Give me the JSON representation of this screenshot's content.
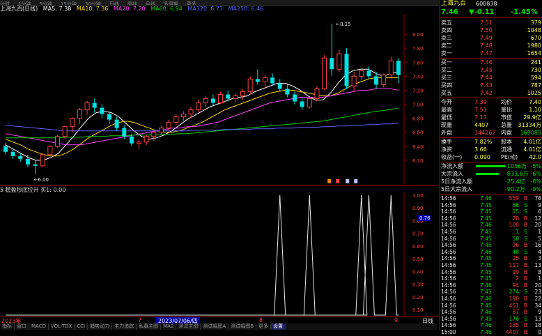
{
  "toolbar": {
    "items": [
      "分时",
      "1分钟",
      "5分钟",
      "15分钟",
      "30分钟",
      "日线",
      "周线",
      "月线",
      "多周期",
      "更多"
    ]
  },
  "header": {
    "title": "上海九百(日线)",
    "ma5": "MA5: 7.38",
    "ma10": "MA10: 7.36",
    "ma20": "MA20: 7.20",
    "ma60": "MA60: 6.94",
    "ma120": "MA120: 6.73",
    "ma250": "MA250: 6.46"
  },
  "colors": {
    "up": "#ff4040",
    "down": "#00e0e0",
    "ma5": "#ffffff",
    "ma10": "#ffd800",
    "ma20": "#ff40ff",
    "ma60": "#00d000",
    "ma120": "#6060ff",
    "ma250": "#e0e0e0"
  },
  "price_axis": {
    "ticks": [
      "8.00",
      "7.80",
      "7.60",
      "7.40",
      "7.20",
      "7.00",
      "6.80",
      "6.60",
      "6.40",
      "6.20"
    ]
  },
  "price_annotations": {
    "high": "8.15",
    "low": "6.00"
  },
  "candles": [
    {
      "o": 6.4,
      "h": 6.45,
      "l": 6.28,
      "c": 6.32
    },
    {
      "o": 6.32,
      "h": 6.36,
      "l": 6.22,
      "c": 6.26
    },
    {
      "o": 6.26,
      "h": 6.3,
      "l": 6.18,
      "c": 6.22
    },
    {
      "o": 6.22,
      "h": 6.28,
      "l": 6.1,
      "c": 6.14
    },
    {
      "o": 6.14,
      "h": 6.2,
      "l": 6.0,
      "c": 6.12
    },
    {
      "o": 6.12,
      "h": 6.3,
      "l": 6.1,
      "c": 6.28
    },
    {
      "o": 6.28,
      "h": 6.42,
      "l": 6.26,
      "c": 6.4
    },
    {
      "o": 6.4,
      "h": 6.56,
      "l": 6.38,
      "c": 6.54
    },
    {
      "o": 6.54,
      "h": 6.7,
      "l": 6.5,
      "c": 6.68
    },
    {
      "o": 6.68,
      "h": 6.82,
      "l": 6.6,
      "c": 6.8
    },
    {
      "o": 6.8,
      "h": 6.95,
      "l": 6.72,
      "c": 6.92
    },
    {
      "o": 6.92,
      "h": 7.05,
      "l": 6.85,
      "c": 7.02
    },
    {
      "o": 7.02,
      "h": 7.08,
      "l": 6.88,
      "c": 6.95
    },
    {
      "o": 6.95,
      "h": 7.0,
      "l": 6.8,
      "c": 6.86
    },
    {
      "o": 6.86,
      "h": 6.9,
      "l": 6.72,
      "c": 6.78
    },
    {
      "o": 6.78,
      "h": 6.82,
      "l": 6.62,
      "c": 6.66
    },
    {
      "o": 6.66,
      "h": 6.7,
      "l": 6.5,
      "c": 6.54
    },
    {
      "o": 6.54,
      "h": 6.58,
      "l": 6.4,
      "c": 6.44
    },
    {
      "o": 6.44,
      "h": 6.5,
      "l": 6.36,
      "c": 6.46
    },
    {
      "o": 6.46,
      "h": 6.56,
      "l": 6.42,
      "c": 6.54
    },
    {
      "o": 6.54,
      "h": 6.62,
      "l": 6.48,
      "c": 6.6
    },
    {
      "o": 6.6,
      "h": 6.7,
      "l": 6.56,
      "c": 6.66
    },
    {
      "o": 6.66,
      "h": 6.78,
      "l": 6.62,
      "c": 6.74
    },
    {
      "o": 6.74,
      "h": 6.86,
      "l": 6.7,
      "c": 6.82
    },
    {
      "o": 6.82,
      "h": 6.9,
      "l": 6.76,
      "c": 6.86
    },
    {
      "o": 6.86,
      "h": 6.96,
      "l": 6.8,
      "c": 6.92
    },
    {
      "o": 6.92,
      "h": 7.06,
      "l": 6.88,
      "c": 7.02
    },
    {
      "o": 7.02,
      "h": 7.12,
      "l": 6.96,
      "c": 7.08
    },
    {
      "o": 7.08,
      "h": 7.14,
      "l": 6.98,
      "c": 7.02
    },
    {
      "o": 7.02,
      "h": 7.18,
      "l": 7.0,
      "c": 7.14
    },
    {
      "o": 7.14,
      "h": 7.2,
      "l": 7.04,
      "c": 7.08
    },
    {
      "o": 7.08,
      "h": 7.16,
      "l": 7.02,
      "c": 7.12
    },
    {
      "o": 7.12,
      "h": 7.22,
      "l": 7.06,
      "c": 7.18
    },
    {
      "o": 7.18,
      "h": 7.4,
      "l": 7.14,
      "c": 7.36
    },
    {
      "o": 7.36,
      "h": 7.5,
      "l": 7.28,
      "c": 7.32
    },
    {
      "o": 7.32,
      "h": 7.42,
      "l": 7.22,
      "c": 7.38
    },
    {
      "o": 7.38,
      "h": 7.44,
      "l": 7.26,
      "c": 7.3
    },
    {
      "o": 7.3,
      "h": 7.36,
      "l": 7.18,
      "c": 7.22
    },
    {
      "o": 7.22,
      "h": 7.3,
      "l": 7.1,
      "c": 7.14
    },
    {
      "o": 7.14,
      "h": 7.18,
      "l": 7.0,
      "c": 7.04
    },
    {
      "o": 7.04,
      "h": 7.1,
      "l": 6.92,
      "c": 6.96
    },
    {
      "o": 6.96,
      "h": 7.1,
      "l": 6.94,
      "c": 7.08
    },
    {
      "o": 7.08,
      "h": 7.26,
      "l": 7.04,
      "c": 7.22
    },
    {
      "o": 7.22,
      "h": 7.7,
      "l": 7.2,
      "c": 7.66
    },
    {
      "o": 7.66,
      "h": 8.15,
      "l": 7.4,
      "c": 7.5
    },
    {
      "o": 7.5,
      "h": 7.78,
      "l": 7.46,
      "c": 7.72
    },
    {
      "o": 7.72,
      "h": 7.8,
      "l": 7.22,
      "c": 7.26
    },
    {
      "o": 7.26,
      "h": 7.46,
      "l": 7.18,
      "c": 7.4
    },
    {
      "o": 7.4,
      "h": 7.52,
      "l": 7.34,
      "c": 7.48
    },
    {
      "o": 7.48,
      "h": 7.54,
      "l": 7.36,
      "c": 7.4
    },
    {
      "o": 7.4,
      "h": 7.46,
      "l": 7.22,
      "c": 7.28
    },
    {
      "o": 7.28,
      "h": 7.44,
      "l": 7.24,
      "c": 7.42
    },
    {
      "o": 7.42,
      "h": 7.68,
      "l": 7.36,
      "c": 7.62
    },
    {
      "o": 7.62,
      "h": 7.66,
      "l": 7.3,
      "c": 7.42
    }
  ],
  "ma_lines": {
    "ma5": [
      6.42,
      6.36,
      6.3,
      6.24,
      6.2,
      6.2,
      6.24,
      6.3,
      6.42,
      6.54,
      6.68,
      6.8,
      6.88,
      6.9,
      6.88,
      6.82,
      6.72,
      6.62,
      6.54,
      6.5,
      6.52,
      6.56,
      6.62,
      6.7,
      6.78,
      6.84,
      6.9,
      6.96,
      7.0,
      7.04,
      7.08,
      7.1,
      7.12,
      7.18,
      7.22,
      7.26,
      7.3,
      7.3,
      7.26,
      7.2,
      7.12,
      7.06,
      7.06,
      7.16,
      7.3,
      7.42,
      7.48,
      7.5,
      7.5,
      7.44,
      7.4,
      7.44,
      7.46
    ],
    "ma10": [
      6.5,
      6.46,
      6.42,
      6.36,
      6.32,
      6.28,
      6.26,
      6.26,
      6.3,
      6.36,
      6.44,
      6.52,
      6.58,
      6.64,
      6.7,
      6.74,
      6.76,
      6.74,
      6.7,
      6.66,
      6.62,
      6.6,
      6.6,
      6.62,
      6.66,
      6.7,
      6.74,
      6.8,
      6.86,
      6.92,
      6.96,
      7.0,
      7.04,
      7.08,
      7.12,
      7.16,
      7.18,
      7.2,
      7.2,
      7.18,
      7.16,
      7.14,
      7.12,
      7.12,
      7.16,
      7.22,
      7.28,
      7.32,
      7.36,
      7.38,
      7.38,
      7.38,
      7.38
    ],
    "ma20": [
      6.58,
      6.56,
      6.54,
      6.52,
      6.5,
      6.48,
      6.46,
      6.44,
      6.42,
      6.42,
      6.42,
      6.44,
      6.46,
      6.48,
      6.5,
      6.52,
      6.54,
      6.56,
      6.58,
      6.6,
      6.62,
      6.64,
      6.66,
      6.66,
      6.68,
      6.68,
      6.7,
      6.72,
      6.74,
      6.78,
      6.82,
      6.86,
      6.9,
      6.94,
      6.98,
      7.02,
      7.04,
      7.06,
      7.08,
      7.1,
      7.1,
      7.1,
      7.1,
      7.12,
      7.14,
      7.16,
      7.18,
      7.2,
      7.2,
      7.22,
      7.22,
      7.22,
      7.2
    ],
    "ma60": [
      6.52,
      6.52,
      6.52,
      6.52,
      6.52,
      6.52,
      6.52,
      6.52,
      6.53,
      6.53,
      6.53,
      6.54,
      6.54,
      6.54,
      6.55,
      6.55,
      6.55,
      6.56,
      6.56,
      6.56,
      6.56,
      6.57,
      6.57,
      6.58,
      6.58,
      6.59,
      6.6,
      6.61,
      6.62,
      6.63,
      6.64,
      6.65,
      6.66,
      6.67,
      6.68,
      6.69,
      6.7,
      6.71,
      6.72,
      6.73,
      6.74,
      6.75,
      6.76,
      6.78,
      6.8,
      6.82,
      6.84,
      6.86,
      6.88,
      6.9,
      6.91,
      6.93,
      6.94
    ],
    "ma120": [
      6.7,
      6.69,
      6.68,
      6.67,
      6.66,
      6.65,
      6.64,
      6.63,
      6.62,
      6.62,
      6.62,
      6.62,
      6.62,
      6.62,
      6.62,
      6.62,
      6.62,
      6.62,
      6.62,
      6.62,
      6.62,
      6.62,
      6.62,
      6.62,
      6.62,
      6.63,
      6.63,
      6.63,
      6.63,
      6.64,
      6.64,
      6.64,
      6.64,
      6.65,
      6.65,
      6.65,
      6.66,
      6.66,
      6.66,
      6.67,
      6.67,
      6.67,
      6.68,
      6.68,
      6.69,
      6.69,
      6.7,
      6.7,
      6.71,
      6.71,
      6.72,
      6.72,
      6.73
    ]
  },
  "indicator": {
    "header": "5 稳盈抄底拉升 买1: 0.00",
    "value_tag": "0.76",
    "signals": [
      41,
      48,
      37,
      49,
      52
    ],
    "axis_ticks": [
      "1.00",
      "0.90",
      "0.80",
      "0.70",
      "0.60",
      "0.50",
      "0.40",
      "0.30",
      "0.20",
      "0.10"
    ]
  },
  "date_bar": {
    "year": "2023年",
    "n1": "7",
    "sel_date": "2023/07/06/四",
    "n2": "8",
    "n3": "9",
    "right": "日线"
  },
  "tabs": [
    "指标",
    "窗口",
    "MACD",
    "VOL-TDX",
    "CCI",
    "趋势动力",
    "主力追踪",
    "私募主图",
    "MA2",
    "测试主图",
    "测试幅图A",
    "测试幅图B",
    "更多",
    "设置"
  ],
  "quote": {
    "name": "上海九百",
    "code": "600838",
    "price": "7.46",
    "change": "▼-0.11",
    "pct": "-1.45%",
    "sell": [
      {
        "label": "卖五",
        "price": "7.51",
        "vol": "379"
      },
      {
        "label": "卖四",
        "price": "7.50",
        "vol": "1048"
      },
      {
        "label": "卖三",
        "price": "7.49",
        "vol": "670"
      },
      {
        "label": "卖二",
        "price": "7.48",
        "vol": "1980"
      },
      {
        "label": "卖一",
        "price": "7.47",
        "vol": "1654"
      }
    ],
    "buy": [
      {
        "label": "买一",
        "price": "7.46",
        "vol": "241"
      },
      {
        "label": "买二",
        "price": "7.45",
        "vol": "730"
      },
      {
        "label": "买三",
        "price": "7.44",
        "vol": "594"
      },
      {
        "label": "买四",
        "price": "7.43",
        "vol": "787"
      },
      {
        "label": "买五",
        "price": "7.42",
        "vol": "1025"
      }
    ],
    "stats": [
      {
        "l1": "今开",
        "v1": "7.39",
        "l2": "均价",
        "v2": "7.40"
      },
      {
        "l1": "最高",
        "v1": "7.51",
        "l2": "量比",
        "v2": "1.10"
      },
      {
        "l1": "最低",
        "v1": "7.17",
        "l2": "市值",
        "v2": "29.9亿"
      },
      {
        "l1": "现量",
        "v1": "4407",
        "l2": "总量",
        "v2": "31334万"
      },
      {
        "l1": "外盘",
        "v1": "144262",
        "l2": "内盘",
        "v2": "169085"
      }
    ],
    "stats2": [
      {
        "l1": "换手",
        "v1": "7.82%",
        "l2": "股本",
        "v2": "4.01亿"
      },
      {
        "l1": "净资",
        "v1": "3.66",
        "l2": "流通",
        "v2": "4.01亿"
      },
      {
        "l1": "收益(一)",
        "v1": "0.090",
        "l2": "PE(动)",
        "v2": "42.0"
      }
    ],
    "flows": [
      {
        "label": "净流入额",
        "bar": 0.7,
        "val": "-1056万",
        "pct": "-5%"
      },
      {
        "label": "大宗流入",
        "bar": 0.55,
        "val": "-833.6万",
        "pct": "-6%"
      },
      {
        "label": "5日净流入额",
        "bar": 0.0,
        "val": "-25.4亿",
        "pct": "-8%"
      },
      {
        "label": "5日大宗流入",
        "bar": 0.0,
        "val": "-90.2万",
        "pct": "-9%"
      }
    ],
    "trades": [
      {
        "t": "14:56",
        "p": "7.46",
        "v": "559",
        "bs": "B",
        "n": "78"
      },
      {
        "t": "14:56",
        "p": "7.45",
        "v": "66",
        "bs": "S",
        "n": "9"
      },
      {
        "t": "14:56",
        "p": "7.45",
        "v": "15",
        "bs": "S",
        "n": "6"
      },
      {
        "t": "14:56",
        "p": "7.45",
        "v": "28",
        "bs": "B",
        "n": "12"
      },
      {
        "t": "14:56",
        "p": "7.46",
        "v": "100",
        "bs": "B",
        "n": "20"
      },
      {
        "t": "14:56",
        "p": "7.45",
        "v": "1",
        "bs": "S",
        "n": "1"
      },
      {
        "t": "14:56",
        "p": "7.45",
        "v": "58",
        "bs": "S",
        "n": "5"
      },
      {
        "t": "14:56",
        "p": "7.45",
        "v": "96",
        "bs": "B",
        "n": "16"
      },
      {
        "t": "14:56",
        "p": "7.46",
        "v": "48",
        "bs": "S",
        "n": "4"
      },
      {
        "t": "14:56",
        "p": "7.45",
        "v": "25",
        "bs": "B",
        "n": "3"
      },
      {
        "t": "14:56",
        "p": "7.45",
        "v": "117",
        "bs": "B",
        "n": "13"
      },
      {
        "t": "14:56",
        "p": "7.45",
        "v": "99",
        "bs": "B",
        "n": "8"
      },
      {
        "t": "14:56",
        "p": "7.45",
        "v": "2",
        "bs": "B",
        "n": "1"
      },
      {
        "t": "14:56",
        "p": "7.46",
        "v": "94",
        "bs": "B",
        "n": "20"
      },
      {
        "t": "14:56",
        "p": "7.45",
        "v": "274",
        "bs": "S",
        "n": "23"
      },
      {
        "t": "14:56",
        "p": "7.46",
        "v": "190",
        "bs": "B",
        "n": "22"
      },
      {
        "t": "14:56",
        "p": "7.45",
        "v": "451",
        "bs": "B",
        "n": "34"
      },
      {
        "t": "14:56",
        "p": "7.46",
        "v": "87",
        "bs": "B",
        "n": "9"
      },
      {
        "t": "14:56",
        "p": "7.45",
        "v": "176",
        "bs": "S",
        "n": "13"
      },
      {
        "t": "14:56",
        "p": "7.46",
        "v": "135",
        "bs": "B",
        "n": "18"
      },
      {
        "t": "15:00",
        "p": "7.46",
        "v": "4407",
        "bs": "B",
        "n": "0"
      }
    ]
  }
}
